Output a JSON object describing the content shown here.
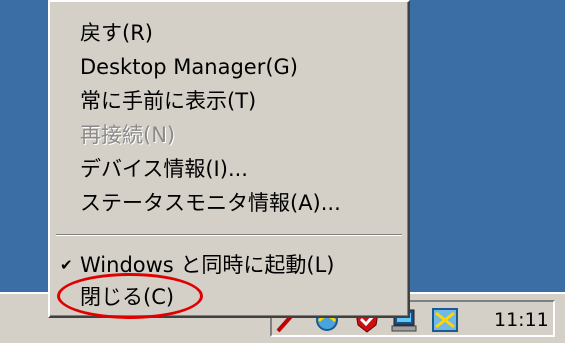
{
  "menu": {
    "items": [
      {
        "label": "戻す(R)",
        "enabled": true
      },
      {
        "label": "Desktop Manager(G)",
        "enabled": true
      },
      {
        "label": "常に手前に表示(T)",
        "enabled": true
      },
      {
        "label": "再接続(N)",
        "enabled": false
      },
      {
        "label": "デバイス情報(I)...",
        "enabled": true
      },
      {
        "label": "ステータスモニタ情報(A)...",
        "enabled": true
      }
    ],
    "startup": {
      "label": "Windows と同時に起動(L)",
      "checked": true,
      "check_mark": "✔"
    },
    "close": {
      "label": "閉じる(C)",
      "highlighted": true
    }
  },
  "taskbar": {
    "clock": "11:11",
    "tray_icons": [
      "pen-icon",
      "network-icon",
      "antivirus-icon",
      "computer-icon",
      "device-manager-icon"
    ]
  },
  "colors": {
    "desktop": "#3a6ea5",
    "face": "#d4d0c8",
    "highlight_ring": "#e00000"
  }
}
